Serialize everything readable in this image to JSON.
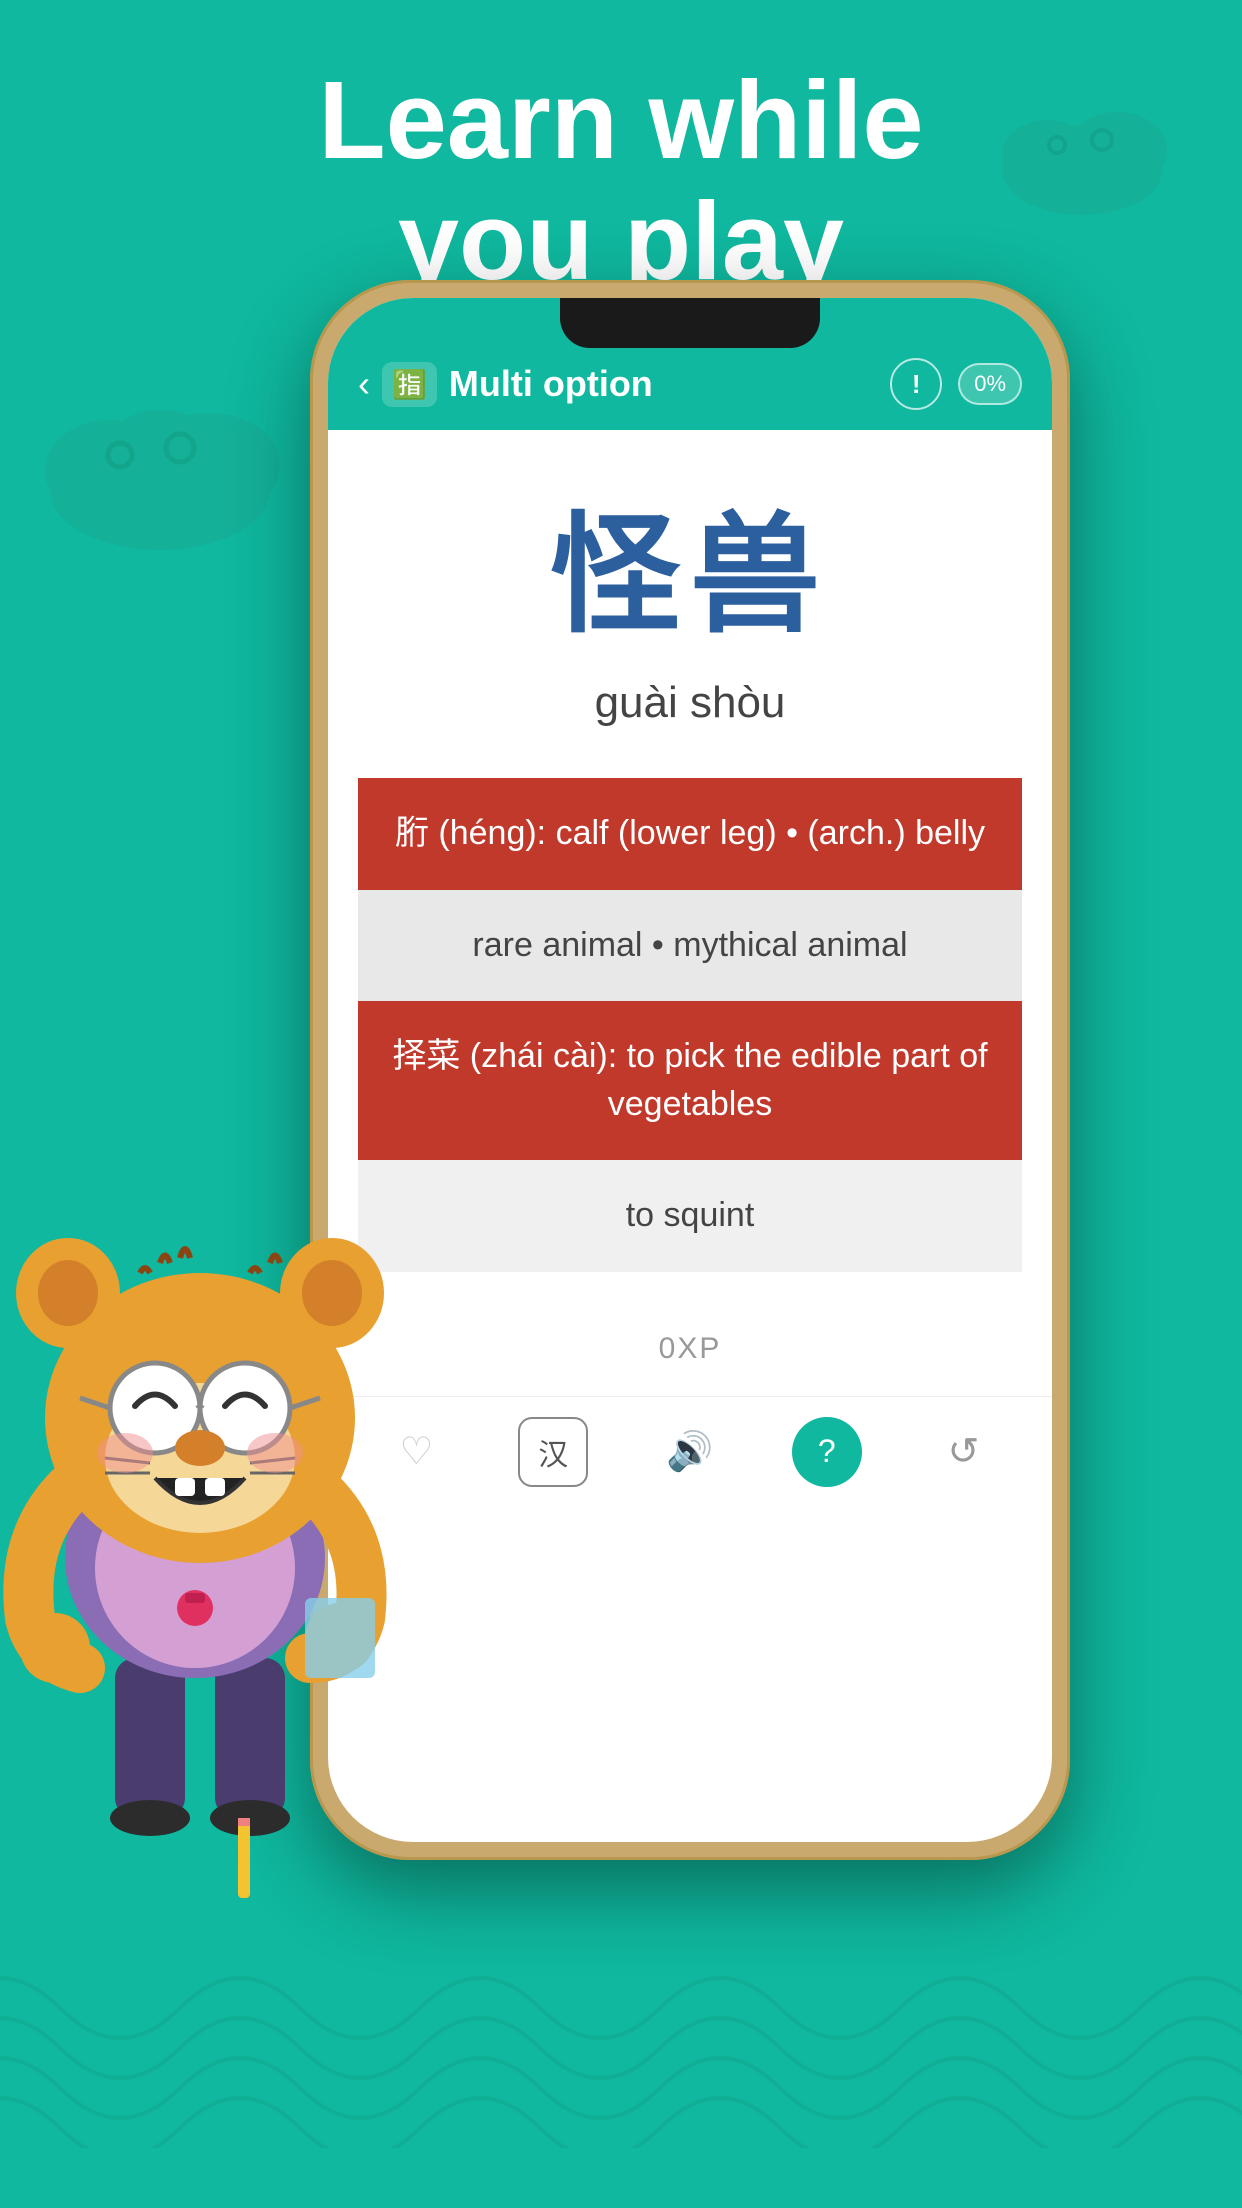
{
  "headline": {
    "line1": "Learn while",
    "line2": "you play"
  },
  "app": {
    "header": {
      "title": "Multi option",
      "back_label": "‹",
      "percent": "0%"
    },
    "word": {
      "chinese": "怪兽",
      "pinyin": "guài shòu"
    },
    "options": [
      {
        "text": "胻 (héng): calf (lower leg) • (arch.) belly",
        "type": "red"
      },
      {
        "text": "rare animal • mythical animal",
        "type": "gray"
      },
      {
        "text": "择菜 (zhái cài): to pick the edible part of vegetables",
        "type": "red"
      },
      {
        "text": "to squint",
        "type": "gray-light"
      }
    ],
    "xp": "0XP",
    "nav": {
      "heart": "♡",
      "hanzi": "汉",
      "speaker": "🔊",
      "question": "?",
      "refresh": "↺"
    }
  }
}
